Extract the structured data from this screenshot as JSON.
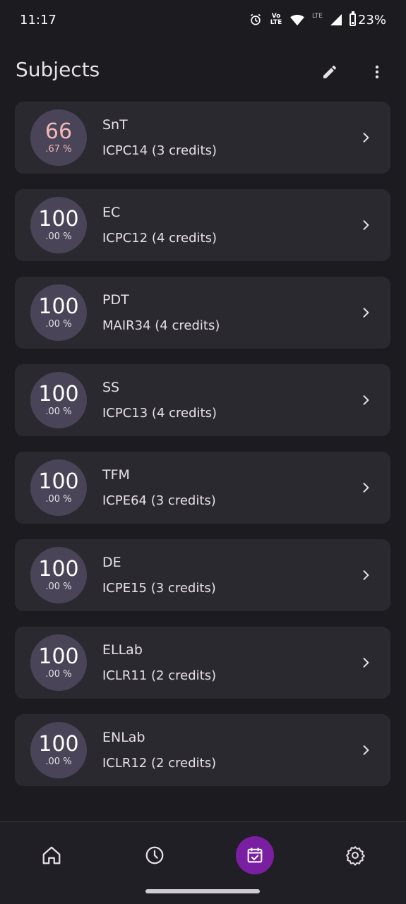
{
  "status_bar": {
    "time": "11:17",
    "volte_label": "Vo LTE",
    "lte_label": "LTE",
    "battery_percent": "23%",
    "icons": [
      "alarm-icon",
      "volte-icon",
      "wifi-icon",
      "signal-icon",
      "battery-icon"
    ]
  },
  "app_bar": {
    "title": "Subjects",
    "actions": [
      "edit-icon",
      "more-vert-icon"
    ]
  },
  "subjects": [
    {
      "percent_int": "66",
      "percent_dec": ".67 %",
      "name": "SnT",
      "code_credits": "ICPC14 (3 credits)",
      "low": true
    },
    {
      "percent_int": "100",
      "percent_dec": ".00 %",
      "name": "EC",
      "code_credits": "ICPC12 (4 credits)",
      "low": false
    },
    {
      "percent_int": "100",
      "percent_dec": ".00 %",
      "name": "PDT",
      "code_credits": "MAIR34 (4 credits)",
      "low": false
    },
    {
      "percent_int": "100",
      "percent_dec": ".00 %",
      "name": "SS",
      "code_credits": "ICPC13 (4 credits)",
      "low": false
    },
    {
      "percent_int": "100",
      "percent_dec": ".00 %",
      "name": "TFM",
      "code_credits": "ICPE64 (3 credits)",
      "low": false
    },
    {
      "percent_int": "100",
      "percent_dec": ".00 %",
      "name": "DE",
      "code_credits": "ICPE15 (3 credits)",
      "low": false
    },
    {
      "percent_int": "100",
      "percent_dec": ".00 %",
      "name": "ELLab",
      "code_credits": "ICLR11 (2 credits)",
      "low": false
    },
    {
      "percent_int": "100",
      "percent_dec": ".00 %",
      "name": "ENLab",
      "code_credits": "ICLR12 (2 credits)",
      "low": false
    }
  ],
  "bottom_nav": {
    "items": [
      "home-icon",
      "history-icon",
      "calendar-check-icon",
      "settings-icon"
    ],
    "selected": "calendar-check-icon"
  },
  "colors": {
    "background": "#1c1b1f",
    "card": "#2b2930",
    "circle": "#4a4458",
    "low_attendance_text": "#f2b8b5",
    "nav_selected": "#7b1fa2"
  }
}
